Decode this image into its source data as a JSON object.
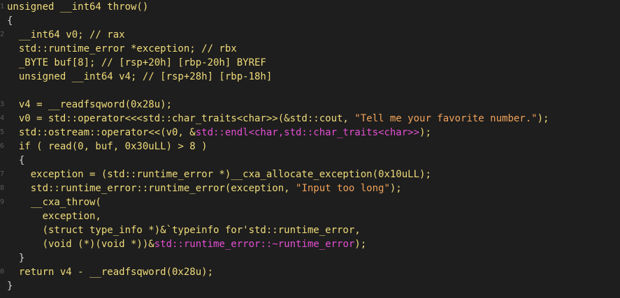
{
  "editor": {
    "lines": [
      [
        {
          "t": "unsigned __int64 throw()",
          "c": "kw"
        }
      ],
      [
        {
          "t": "{",
          "c": "pu"
        }
      ],
      [
        {
          "t": "  __int64 v0; // rax",
          "c": "va"
        }
      ],
      [
        {
          "t": "  std::runtime_error *exception; // rbx",
          "c": "va"
        }
      ],
      [
        {
          "t": "  _BYTE buf[8]; // [rsp+20h] [rbp-20h] BYREF",
          "c": "va"
        }
      ],
      [
        {
          "t": "  unsigned __int64 v4; // [rsp+28h] [rbp-18h]",
          "c": "va"
        }
      ],
      [
        {
          "t": "",
          "c": "pu"
        }
      ],
      [
        {
          "t": "  v4 = __readfsqword(0x28u);",
          "c": "va"
        }
      ],
      [
        {
          "t": "  v0 = std::operator<<<std::char_traits<char>>(&std::cout, ",
          "c": "va"
        },
        {
          "t": "\"Tell me your favorite number.\"",
          "c": "st"
        },
        {
          "t": ");",
          "c": "va"
        }
      ],
      [
        {
          "t": "  std::ostream::operator<<(v0, &",
          "c": "va"
        },
        {
          "t": "std::endl<char,std::char_traits<char>>",
          "c": "mg"
        },
        {
          "t": ");",
          "c": "va"
        }
      ],
      [
        {
          "t": "  if ( read(0, buf, 0x30uLL) > 8 )",
          "c": "va"
        }
      ],
      [
        {
          "t": "  {",
          "c": "pu"
        }
      ],
      [
        {
          "t": "    exception = (std::runtime_error *)__cxa_allocate_exception(0x10uLL);",
          "c": "va"
        }
      ],
      [
        {
          "t": "    std::runtime_error::runtime_error(exception, ",
          "c": "va"
        },
        {
          "t": "\"Input too long\"",
          "c": "st"
        },
        {
          "t": ");",
          "c": "va"
        }
      ],
      [
        {
          "t": "    __cxa_throw(",
          "c": "va"
        }
      ],
      [
        {
          "t": "      exception,",
          "c": "va"
        }
      ],
      [
        {
          "t": "      (struct type_info *)&`typeinfo for'std::runtime_error,",
          "c": "va"
        }
      ],
      [
        {
          "t": "      (void (*)(void *))&",
          "c": "va"
        },
        {
          "t": "std::runtime_error::~runtime_error",
          "c": "mg"
        },
        {
          "t": ");",
          "c": "va"
        }
      ],
      [
        {
          "t": "  }",
          "c": "pu"
        }
      ],
      [
        {
          "t": "  return v4 - __readfsqword(0x28u);",
          "c": "va"
        }
      ],
      [
        {
          "t": "}",
          "c": "pu"
        }
      ]
    ],
    "gutter_marks": [
      "1",
      "",
      "2",
      "",
      "",
      "",
      "",
      "3",
      "4",
      "5",
      "6",
      "",
      "7",
      "8",
      "9",
      "",
      "",
      "",
      "",
      "0",
      ""
    ],
    "colors": {
      "background": "#1e1e1e",
      "variable": "#f0dc7a",
      "string": "#f0a35a",
      "magenta": "#e44fd3",
      "punctuation": "#d4d4d4"
    }
  }
}
